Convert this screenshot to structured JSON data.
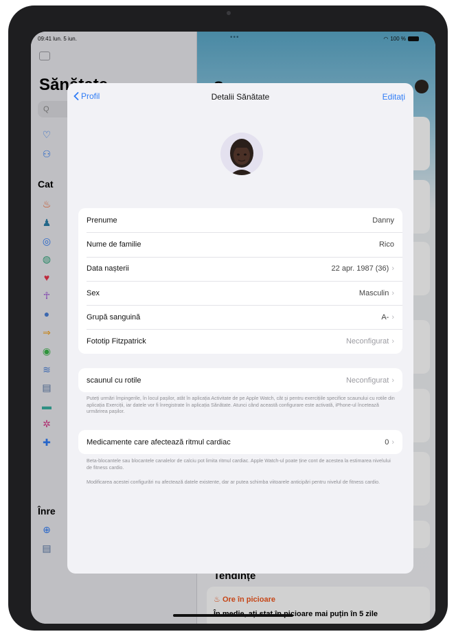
{
  "status_bar": {
    "time": "09:41 lun. 5 iun.",
    "dots": "•••",
    "battery": "100 %"
  },
  "sidebar": {
    "title": "Sănătate",
    "search_placeholder": "Q",
    "categories_heading": "Cat",
    "records_heading": "Înre",
    "icons": [
      {
        "name": "heart-outline-icon",
        "glyph": "♡",
        "color": "#2f7cf6"
      },
      {
        "name": "people-icon",
        "glyph": "⚇",
        "color": "#2f7cf6"
      },
      {
        "name": "flame-icon",
        "glyph": "♨",
        "color": "#f2561d"
      },
      {
        "name": "body-measurements-icon",
        "glyph": "♟",
        "color": "#2a7ea8"
      },
      {
        "name": "ear-icon",
        "glyph": "◎",
        "color": "#2f7cf6"
      },
      {
        "name": "mind-icon",
        "glyph": "◍",
        "color": "#34a67d"
      },
      {
        "name": "heart-icon",
        "glyph": "♥",
        "color": "#e8344a"
      },
      {
        "name": "mobility-icon",
        "glyph": "☥",
        "color": "#9b4ed6"
      },
      {
        "name": "cycle-icon",
        "glyph": "●",
        "color": "#4a7fd6"
      },
      {
        "name": "arrow-icon",
        "glyph": "⇒",
        "color": "#f2a11d"
      },
      {
        "name": "apple-icon",
        "glyph": "◉",
        "color": "#3bb54a"
      },
      {
        "name": "respiratory-icon",
        "glyph": "≋",
        "color": "#4a7fd6"
      },
      {
        "name": "clipboard-icon",
        "glyph": "▤",
        "color": "#5a78a6"
      },
      {
        "name": "sleep-icon",
        "glyph": "▬",
        "color": "#39b0a0"
      },
      {
        "name": "symptoms-icon",
        "glyph": "✲",
        "color": "#d63a8a"
      },
      {
        "name": "plus-icon",
        "glyph": "✚",
        "color": "#2f7cf6"
      },
      {
        "name": "record-plus-icon",
        "glyph": "⊕",
        "color": "#2f7cf6"
      },
      {
        "name": "document-icon",
        "glyph": "▤",
        "color": "#5a78a6"
      }
    ]
  },
  "background": {
    "title": "S",
    "trends_heading": "Tendințe",
    "trend_item": "Ore în picioare",
    "trend_text": "În medie, ați stat în picioare mai puțin în 5 zile"
  },
  "sheet": {
    "nav": {
      "back_label": "Profil",
      "title": "Detalii Sănătate",
      "edit_label": "Editați"
    },
    "details": [
      {
        "label": "Prenume",
        "value": "Danny",
        "chevron": false,
        "muted": false
      },
      {
        "label": "Nume de familie",
        "value": "Rico",
        "chevron": false,
        "muted": false
      },
      {
        "label": "Data nașterii",
        "value": "22 apr. 1987 (36)",
        "chevron": true,
        "muted": false
      },
      {
        "label": "Sex",
        "value": "Masculin",
        "chevron": true,
        "muted": false
      },
      {
        "label": "Grupă sanguină",
        "value": "A-",
        "chevron": true,
        "muted": false
      },
      {
        "label": "Fototip Fitzpatrick",
        "value": "Neconfigurat",
        "chevron": true,
        "muted": true
      }
    ],
    "wheelchair": {
      "label": "scaunul cu rotile",
      "value": "Neconfigurat",
      "footnote": "Puteți urmări împingerile, în locul pașilor, atât în aplicația Activitate de pe Apple Watch, cât și pentru exercițiile specifice scaunului cu rotile din aplicația Exerciții, iar datele vor fi înregistrate în aplicația Sănătate. Atunci când această configurare este activată, iPhone-ul încetează urmărirea pașilor."
    },
    "medications": {
      "label": "Medicamente care afectează ritmul cardiac",
      "value": "0",
      "footnote1": "Beta-blocantele sau blocantele canalelor de calciu pot limita ritmul cardiac. Apple Watch-ul poate ține cont de acestea la estimarea nivelului de fitness cardio.",
      "footnote2": "Modificarea acestei configurări nu afectează datele existente, dar ar putea schimba viitoarele anticipări pentru nivelul de fitness cardio."
    }
  }
}
